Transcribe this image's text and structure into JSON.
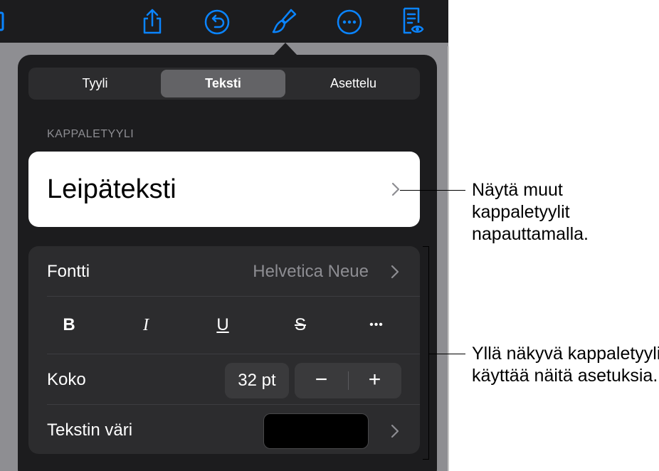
{
  "toolbar": {
    "icons": [
      "share-icon",
      "undo-icon",
      "format-brush-icon",
      "more-icon",
      "reader-view-icon"
    ]
  },
  "tabs": [
    {
      "label": "Tyyli",
      "active": false
    },
    {
      "label": "Teksti",
      "active": true
    },
    {
      "label": "Asettelu",
      "active": false
    }
  ],
  "paragraph_style": {
    "section_label": "KAPPALETYYLI",
    "name": "Leipäteksti"
  },
  "font": {
    "label": "Fontti",
    "value": "Helvetica Neue"
  },
  "format_buttons": {
    "bold": "B",
    "italic": "I",
    "underline": "U",
    "strike": "S",
    "more": "•••"
  },
  "size": {
    "label": "Koko",
    "value": "32 pt",
    "minus": "−",
    "plus": "+"
  },
  "text_color": {
    "label": "Tekstin väri",
    "value": "#000000"
  },
  "callouts": {
    "top": [
      "Näytä muut",
      "kappaletyylit",
      "napauttamalla."
    ],
    "bottom": [
      "Yllä näkyvä kappaletyyli",
      "käyttää näitä asetuksia."
    ]
  },
  "colors": {
    "toolbar_icon": "#0a84ff",
    "popover_bg": "#1c1c1e",
    "group_bg": "#2c2c2e"
  }
}
